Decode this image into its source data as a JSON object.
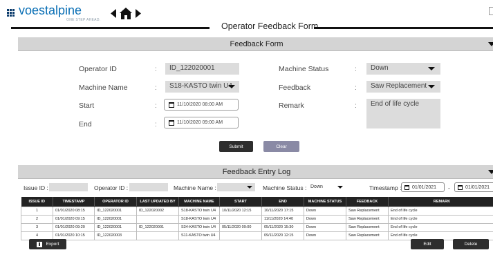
{
  "header": {
    "logo_text": "voestalpine",
    "tagline": "ONE STEP AHEAD.",
    "page_title": "Operator Feedback Form"
  },
  "form_panel": {
    "title": "Feedback Form",
    "operator_id_label": "Operator ID",
    "operator_id_value": "ID_122020001",
    "machine_name_label": "Machine Name",
    "machine_name_value": "S18-KASTO twin U4",
    "start_label": "Start",
    "start_value": "11/10/2020 08:00 AM",
    "end_label": "End",
    "end_value": "11/10/2020 09:00 AM",
    "machine_status_label": "Machine Status",
    "machine_status_value": "Down",
    "feedback_label": "Feedback",
    "feedback_value": "Saw Replacement",
    "remark_label": "Remark",
    "remark_value": "End of life cycle",
    "colon": ":",
    "submit_label": "Submit",
    "clear_label": "Clear"
  },
  "log_panel": {
    "title": "Feedback Entry Log",
    "filters": {
      "issue_id_label": "Issue ID :",
      "operator_id_label": "Operator ID :",
      "machine_name_label": "Machine Name :",
      "machine_status_label": "Machine Status :",
      "machine_status_value": "Down",
      "timestamp_label": "Timestamp :",
      "date_from": "01/01/2021",
      "date_separator": "-",
      "date_to": "01/01/2021"
    },
    "columns": [
      "ISSUE ID",
      "TIMESTAMP",
      "OPERATOR ID",
      "LAST UPDATED BY",
      "MACHINE NAME",
      "START",
      "END",
      "MACHINE STATUS",
      "FEEDBACK",
      "REMARK"
    ],
    "rows": [
      [
        "1",
        "01/01/2020 08:15",
        "ID_122020001",
        "ID_122020002",
        "S18-KASTO twin U4",
        "10/11/2020 12:15",
        "10/11/2020 17:15",
        "Down",
        "Saw Replacement",
        "End of life cycle"
      ],
      [
        "2",
        "01/01/2020 09:15",
        "ID_122020001",
        "",
        "S18-KASTO twin U4",
        "",
        "11/11/2020 14:40",
        "Down",
        "Saw Replacement",
        "End of life cycle"
      ],
      [
        "3",
        "01/01/2020 09:20",
        "ID_122020001",
        "ID_122020001",
        "S34-KASTO twin U4",
        "05/11/2020 09:00",
        "05/11/2020 15:30",
        "Down",
        "Saw Replacement",
        "End of life cycle"
      ],
      [
        "4",
        "01/01/2020 10:15",
        "ID_122020003",
        "",
        "S11-KASTO twin U4",
        "",
        "09/11/2020 12:15",
        "Down",
        "Saw Replacement",
        "End of life cycle"
      ]
    ],
    "export_label": "Export",
    "edit_label": "Edit",
    "delete_label": "Delete"
  },
  "colors": {
    "brand": "#0a6fb5",
    "panel_header": "#d4d4d4",
    "button_dark": "#2d2d2d",
    "button_clear": "#8a8aa5"
  }
}
